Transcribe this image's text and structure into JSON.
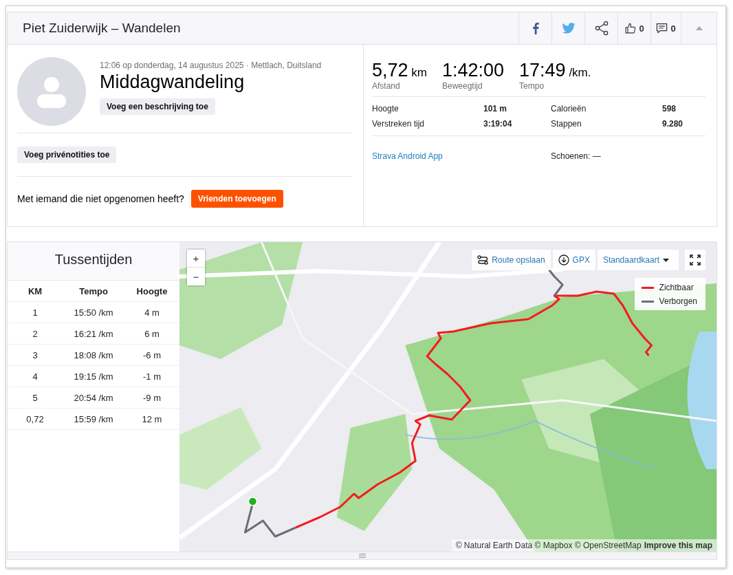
{
  "header": {
    "title": "Piet Zuiderwijk – Wandelen",
    "actions": [
      {
        "kind": "facebook"
      },
      {
        "kind": "twitter"
      },
      {
        "kind": "share"
      },
      {
        "kind": "kudos",
        "count": "0"
      },
      {
        "kind": "comments",
        "count": "0"
      },
      {
        "kind": "collapse"
      }
    ]
  },
  "activity": {
    "meta": "12:06 op donderdag, 14 augustus 2025 · Mettlach, Duitsland",
    "name": "Middagwandeling",
    "description_button": "Voeg een beschrijving toe",
    "notes_button": "Voeg privénotities toe",
    "friends_prompt": "Met iemand die niet opgenomen heeft?",
    "friends_button": "Vrienden toevoegen"
  },
  "stats": {
    "primary": [
      {
        "value": "5,72",
        "unit": "km",
        "label": "Afstand"
      },
      {
        "value": "1:42:00",
        "label": "Beweegtijd"
      },
      {
        "value": "17:49",
        "unit": "/km.",
        "label": "Tempo"
      }
    ],
    "secondary": [
      {
        "label": "Hoogte",
        "value": "101 m"
      },
      {
        "label": "Calorieën",
        "value": "598"
      },
      {
        "label": "Verstreken tijd",
        "value": "3:19:04"
      },
      {
        "label": "Stappen",
        "value": "9.280"
      }
    ],
    "device": "Strava Android App",
    "shoes": "Schoenen: —"
  },
  "splits": {
    "title": "Tussentijden",
    "columns": [
      "KM",
      "Tempo",
      "Hoogte"
    ],
    "rows": [
      {
        "km": "1",
        "pace": "15:50 /km",
        "elevation": "4 m"
      },
      {
        "km": "2",
        "pace": "16:21 /km",
        "elevation": "6 m"
      },
      {
        "km": "3",
        "pace": "18:08 /km",
        "elevation": "-6 m"
      },
      {
        "km": "4",
        "pace": "19:15 /km",
        "elevation": "-1 m"
      },
      {
        "km": "5",
        "pace": "20:54 /km",
        "elevation": "-9 m"
      },
      {
        "km": "0,72",
        "pace": "15:59 /km",
        "elevation": "12 m"
      }
    ]
  },
  "map": {
    "kind": "picture",
    "zoom_in": "+",
    "zoom_out": "−",
    "save_route": "Route opslaan",
    "gpx": "GPX",
    "map_style": "Standaardkaart",
    "legend": [
      {
        "label": "Zichtbaar",
        "color": "#f21c1c"
      },
      {
        "label": "Verborgen",
        "color": "#6e6b78"
      }
    ],
    "attribution": "© Natural Earth Data © Mapbox © OpenStreetMap",
    "improve_link": "Improve this map"
  }
}
